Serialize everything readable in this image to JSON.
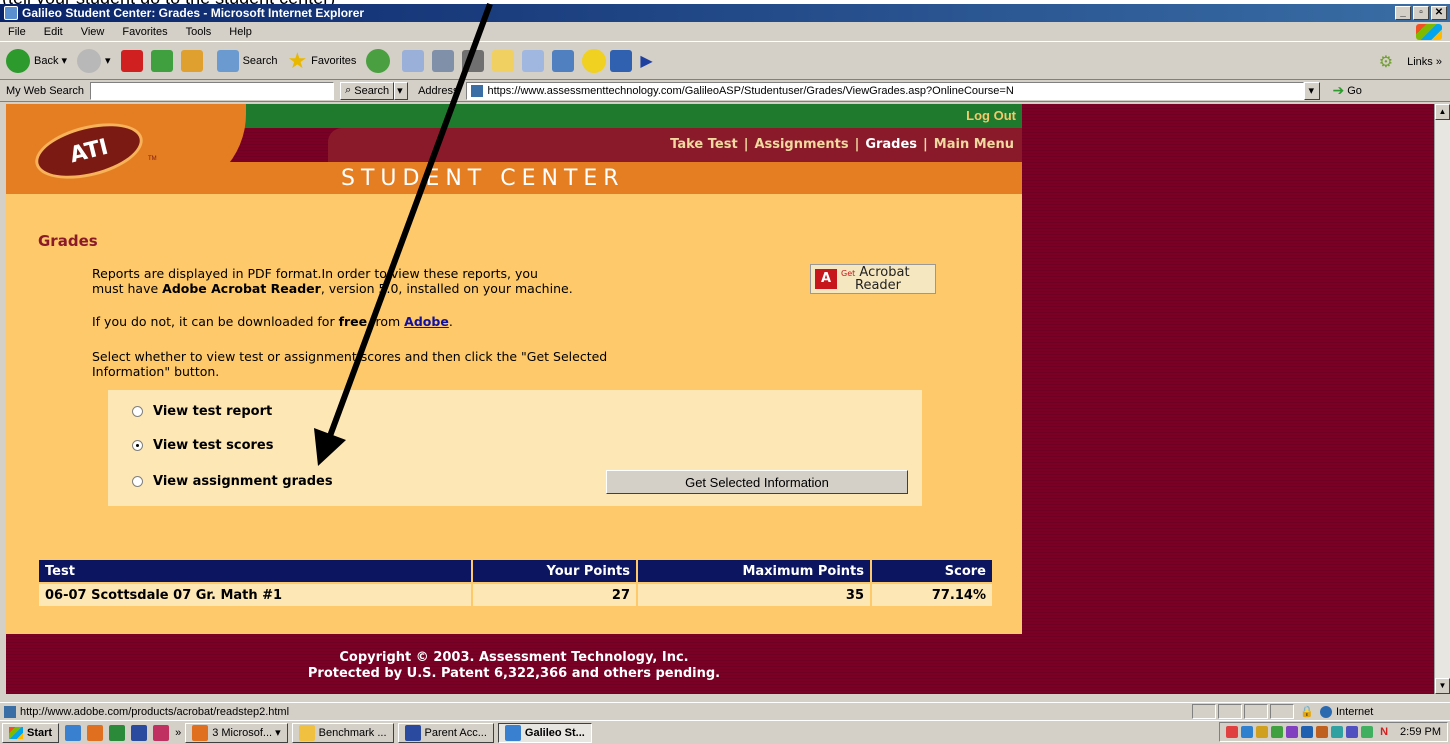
{
  "window": {
    "title": "Galileo Student Center: Grades - Microsoft Internet Explorer"
  },
  "menubar": [
    "File",
    "Edit",
    "View",
    "Favorites",
    "Tools",
    "Help"
  ],
  "toolbar": {
    "back": "Back",
    "search": "Search",
    "favorites": "Favorites",
    "links": "Links"
  },
  "addressbar": {
    "my_web_search": "My Web Search",
    "search_button": "Search",
    "address_label": "Address",
    "url": "https://www.assessmenttechnology.com/GalileoASP/Studentuser/Grades/ViewGrades.asp?OnlineCourse=N",
    "go": "Go"
  },
  "page": {
    "logo_text": "ATI",
    "logo_tm": "TM",
    "logout": "Log Out",
    "nav": {
      "take_test": "Take Test",
      "assignments": "Assignments",
      "grades": "Grades",
      "main_menu": "Main Menu",
      "separator": "|"
    },
    "section_title": "STUDENT CENTER",
    "heading": "Grades",
    "para1_a": "Reports are displayed in PDF format.In order to view these reports, you",
    "para1_b1": "must have ",
    "para1_b2": "Adobe Acrobat Reader",
    "para1_b3": ", version 5.0, installed on your machine.",
    "acrobat": {
      "get": "Get",
      "brand1": "Acrobat",
      "brand2": "Reader",
      "adobe": "Adobe"
    },
    "para2_a": "If you do not, it can be downloaded for ",
    "para2_b": "free",
    "para2_c": " from ",
    "para2_link": "Adobe",
    "para2_d": ".",
    "para3_a": "Select whether to view test or assignment scores and then click the \"Get Selected",
    "para3_b": "Information\" button.",
    "options": {
      "test_report": "View test report",
      "test_scores": "View test scores",
      "assignment_grades": "View assignment grades"
    },
    "get_button": "Get Selected Information",
    "table": {
      "headers": [
        "Test",
        "Your Points",
        "Maximum Points",
        "Score"
      ],
      "rows": [
        [
          "06-07 Scottsdale 07 Gr. Math #1",
          "27",
          "35",
          "77.14%"
        ]
      ]
    },
    "footer1": "Copyright © 2003. Assessment Technology, Inc.",
    "footer2": "Protected by U.S. Patent 6,322,366 and others pending."
  },
  "statusbar": {
    "url": "http://www.adobe.com/products/acrobat/readstep2.html",
    "zone": "Internet"
  },
  "taskbar": {
    "start": "Start",
    "chevron": "»",
    "tasks": [
      "3 Microsof...",
      "Benchmark ...",
      "Parent Acc...",
      "Galileo St..."
    ],
    "clock": "2:59 PM"
  }
}
